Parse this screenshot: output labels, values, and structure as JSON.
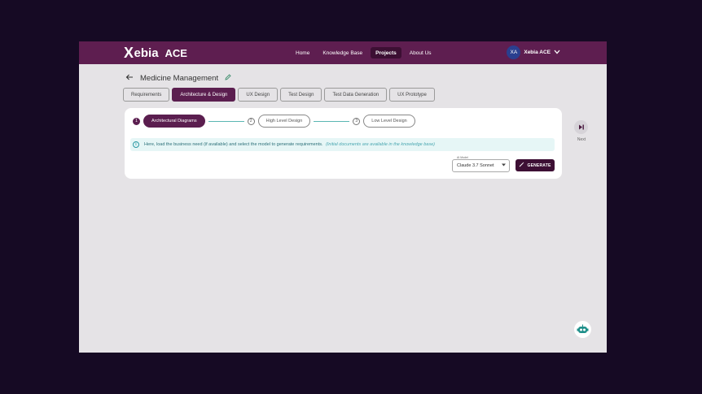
{
  "header": {
    "logo_x": "X",
    "logo_rest": "ebia",
    "logo_ace": "ACE",
    "nav": [
      {
        "label": "Home"
      },
      {
        "label": "Knowledge Base"
      },
      {
        "label": "Projects"
      },
      {
        "label": "About Us"
      }
    ],
    "user": {
      "initials": "XA",
      "name": "Xebia ACE"
    }
  },
  "page": {
    "title": "Medicine Management"
  },
  "tabs": [
    {
      "label": "Requirements"
    },
    {
      "label": "Architecture & Design"
    },
    {
      "label": "UX Design"
    },
    {
      "label": "Test Design"
    },
    {
      "label": "Test Data Generation"
    },
    {
      "label": "UX Prototype"
    }
  ],
  "stepper": [
    {
      "num": "1",
      "label": "Architectural Diagrams"
    },
    {
      "num": "2",
      "label": "High Level Design"
    },
    {
      "num": "3",
      "label": "Low Level Design"
    }
  ],
  "info": {
    "icon": "i",
    "text": "Here, load the business need (if available) and select the model to generate requirements.",
    "note": "(Initial documents are available in the knowledge base)"
  },
  "model": {
    "label": "AI Model",
    "value": "Claude 3.7 Sonnet"
  },
  "generate": {
    "label": "GENERATE"
  },
  "next": {
    "label": "Next"
  },
  "colors": {
    "brand": "#5e1e50",
    "accent": "#5b1e4f",
    "info_bg": "#e6f6f6"
  }
}
